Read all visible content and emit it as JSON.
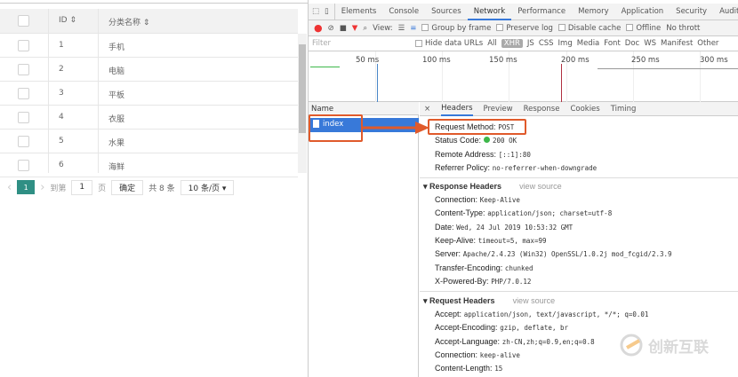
{
  "table": {
    "headers": {
      "id": "ID ⇕",
      "name": "分类名称 ⇕"
    },
    "rows": [
      {
        "id": "1",
        "name": "手机"
      },
      {
        "id": "2",
        "name": "电脑"
      },
      {
        "id": "3",
        "name": "平板"
      },
      {
        "id": "4",
        "name": "衣服"
      },
      {
        "id": "5",
        "name": "水果"
      },
      {
        "id": "6",
        "name": "海鲜"
      }
    ]
  },
  "pager": {
    "prev": "‹",
    "current": "1",
    "next": "›",
    "goto": "到第",
    "page_input": "1",
    "page_unit": "页",
    "confirm": "确定",
    "total": "共 8 条",
    "per_page": "10 条/页 ▾"
  },
  "devtools": {
    "tabs": [
      "Elements",
      "Console",
      "Sources",
      "Network",
      "Performance",
      "Memory",
      "Application",
      "Security",
      "Audits"
    ],
    "active_tab": "Network",
    "toolbar": {
      "view": "View:",
      "group_by_frame": "Group by frame",
      "preserve_log": "Preserve log",
      "disable_cache": "Disable cache",
      "offline": "Offline",
      "throttle": "No thrott"
    },
    "filter": {
      "placeholder": "Filter",
      "hide_data_urls": "Hide data URLs",
      "types": [
        "All",
        "XHR",
        "JS",
        "CSS",
        "Img",
        "Media",
        "Font",
        "Doc",
        "WS",
        "Manifest",
        "Other"
      ],
      "active_type": "XHR"
    },
    "timeline_ticks": [
      "50 ms",
      "100 ms",
      "150 ms",
      "200 ms",
      "250 ms",
      "300 ms"
    ],
    "name_header": "Name",
    "request": "index",
    "detail_tabs": [
      "Headers",
      "Preview",
      "Response",
      "Cookies",
      "Timing"
    ],
    "close": "×",
    "general": [
      {
        "k": "Request Method:",
        "v": "POST"
      },
      {
        "k": "Status Code:",
        "v": "200 OK"
      },
      {
        "k": "Remote Address:",
        "v": "[::1]:80"
      },
      {
        "k": "Referrer Policy:",
        "v": "no-referrer-when-downgrade"
      }
    ],
    "response_title": "▾ Response Headers",
    "view_source": "view source",
    "response_headers": [
      {
        "k": "Connection:",
        "v": "Keep-Alive"
      },
      {
        "k": "Content-Type:",
        "v": "application/json; charset=utf-8"
      },
      {
        "k": "Date:",
        "v": "Wed, 24 Jul 2019 10:53:32 GMT"
      },
      {
        "k": "Keep-Alive:",
        "v": "timeout=5, max=99"
      },
      {
        "k": "Server:",
        "v": "Apache/2.4.23 (Win32) OpenSSL/1.0.2j mod_fcgid/2.3.9"
      },
      {
        "k": "Transfer-Encoding:",
        "v": "chunked"
      },
      {
        "k": "X-Powered-By:",
        "v": "PHP/7.0.12"
      }
    ],
    "request_title": "▾ Request Headers",
    "request_headers": [
      {
        "k": "Accept:",
        "v": "application/json, text/javascript, */*; q=0.01"
      },
      {
        "k": "Accept-Encoding:",
        "v": "gzip, deflate, br"
      },
      {
        "k": "Accept-Language:",
        "v": "zh-CN,zh;q=0.9,en;q=0.8"
      },
      {
        "k": "Connection:",
        "v": "keep-alive"
      },
      {
        "k": "Content-Length:",
        "v": "15"
      }
    ],
    "colors": {
      "accent": "#3879d9",
      "highlight": "#e05a2b",
      "status_ok": "#3db74a",
      "pager": "#2f8f84"
    }
  },
  "watermark": "创新互联"
}
